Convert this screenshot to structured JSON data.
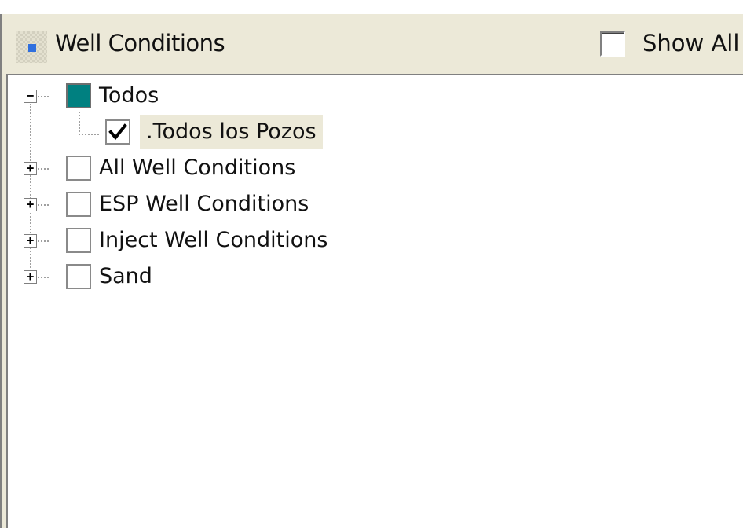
{
  "header": {
    "title": "Well Conditions",
    "show_all_label": "Show All",
    "show_all_checked": false
  },
  "tree": {
    "items": [
      {
        "label": "Todos",
        "expander": "−",
        "swatch_color": "#008080"
      },
      {
        "label": ".Todos los Pozos",
        "checked": true,
        "selected": true
      },
      {
        "label": "All Well Conditions",
        "expander": "+",
        "checked": false
      },
      {
        "label": "ESP Well Conditions",
        "expander": "+",
        "checked": false
      },
      {
        "label": "Inject Well Conditions",
        "expander": "+",
        "checked": false
      },
      {
        "label": "Sand",
        "expander": "+",
        "checked": false
      }
    ]
  }
}
